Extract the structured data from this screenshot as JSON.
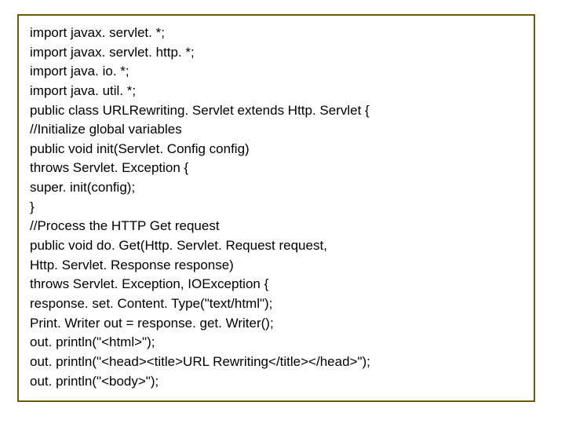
{
  "code": {
    "lines": [
      "import javax. servlet. *;",
      "import javax. servlet. http. *;",
      "import java. io. *;",
      "import java. util. *;",
      "public class URLRewriting. Servlet extends Http. Servlet {",
      "//Initialize global variables",
      "public void init(Servlet. Config config)",
      "throws Servlet. Exception {",
      "super. init(config);",
      "}",
      "//Process the HTTP Get request",
      "public void do. Get(Http. Servlet. Request request,",
      "Http. Servlet. Response response)",
      "throws Servlet. Exception, IOException {",
      "response. set. Content. Type(\"text/html\");",
      "Print. Writer out = response. get. Writer();",
      "out. println(\"<html>\");",
      "out. println(\"<head><title>URL Rewriting</title></head>\");",
      "out. println(\"<body>\");"
    ]
  }
}
